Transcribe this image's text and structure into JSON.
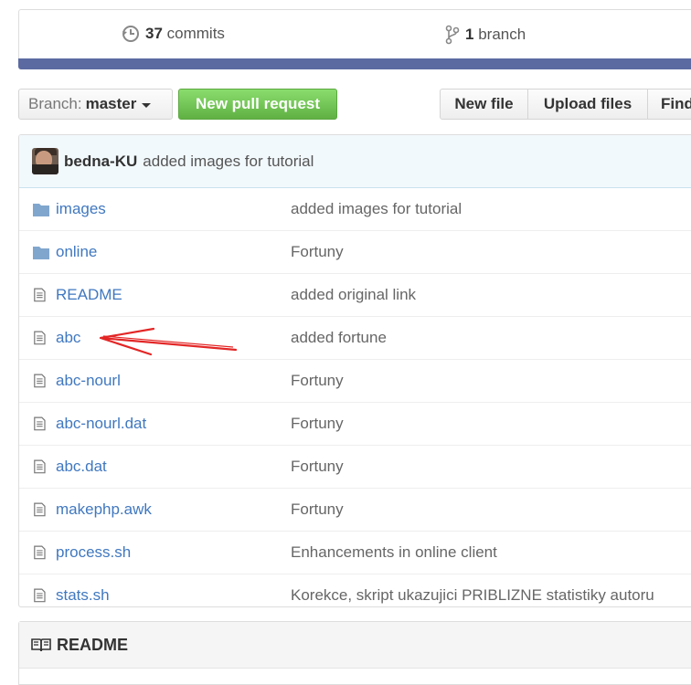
{
  "summary": {
    "commits_count": "37",
    "commits_label": "commits",
    "branch_count": "1",
    "branch_label": "branch"
  },
  "toolbar": {
    "branch_prefix": "Branch:",
    "branch_name": "master",
    "new_pull_request": "New pull request",
    "new_file": "New file",
    "upload_files": "Upload files",
    "find_file": "Find"
  },
  "latest_commit": {
    "author": "bedna-KU",
    "message": "added images for tutorial"
  },
  "files": [
    {
      "name": "images",
      "type": "folder",
      "message": "added images for tutorial"
    },
    {
      "name": "online",
      "type": "folder",
      "message": "Fortuny"
    },
    {
      "name": "README",
      "type": "file",
      "message": "added original link"
    },
    {
      "name": "abc",
      "type": "file",
      "message": "added fortune"
    },
    {
      "name": "abc-nourl",
      "type": "file",
      "message": "Fortuny"
    },
    {
      "name": "abc-nourl.dat",
      "type": "file",
      "message": "Fortuny"
    },
    {
      "name": "abc.dat",
      "type": "file",
      "message": "Fortuny"
    },
    {
      "name": "makephp.awk",
      "type": "file",
      "message": "Fortuny"
    },
    {
      "name": "process.sh",
      "type": "file",
      "message": "Enhancements in online client"
    },
    {
      "name": "stats.sh",
      "type": "file",
      "message": "Korekce, skript ukazujici PRIBLIZNE statistiky autoru"
    }
  ],
  "readme": {
    "title": "README"
  },
  "icons": {
    "commits": "history-icon",
    "branch": "git-branch-icon",
    "folder": "folder-icon",
    "file": "file-text-icon",
    "readme": "book-icon"
  },
  "colors": {
    "link": "#4078c0",
    "summary_bar": "#5b6aa1",
    "pr_button": "#6cc644",
    "annotation_arrow": "#e32626"
  }
}
